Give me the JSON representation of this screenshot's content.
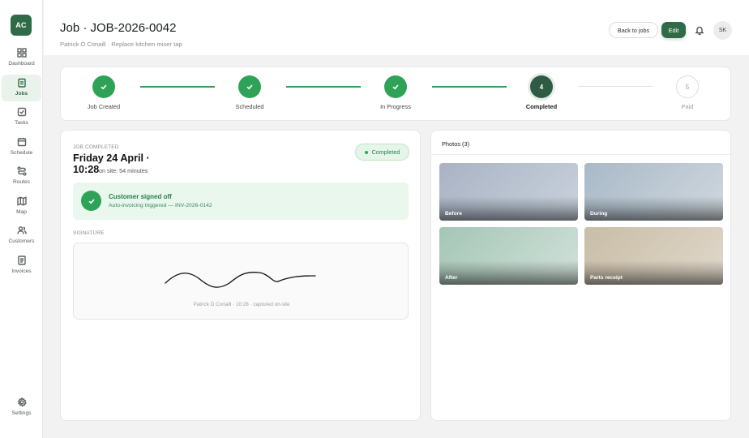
{
  "sidebar": {
    "logo": "AC",
    "items": [
      {
        "label": "Dashboard",
        "icon": "grid-icon"
      },
      {
        "label": "Jobs",
        "icon": "clipboard-icon",
        "active": true
      },
      {
        "label": "Tasks",
        "icon": "checkbox-icon"
      },
      {
        "label": "Schedule",
        "icon": "calendar-icon"
      },
      {
        "label": "Routes",
        "icon": "route-icon"
      },
      {
        "label": "Map",
        "icon": "map-icon"
      },
      {
        "label": "Customers",
        "icon": "users-icon"
      },
      {
        "label": "Invoices",
        "icon": "document-icon"
      }
    ],
    "settings": {
      "label": "Settings",
      "icon": "gear-icon"
    }
  },
  "header": {
    "title": "Job · JOB-2026-0042",
    "subtitle": "Patrick Ó Conaill · Replace kitchen mixer tap",
    "back_label": "Back to jobs",
    "edit_label": "Edit",
    "avatar_initials": "SK"
  },
  "stepper": {
    "steps": [
      {
        "label": "Job Created",
        "state": "done"
      },
      {
        "label": "Scheduled",
        "state": "done"
      },
      {
        "label": "In Progress",
        "state": "done"
      },
      {
        "label": "Completed",
        "state": "current",
        "number": "4"
      },
      {
        "label": "Paid",
        "state": "pending",
        "number": "5"
      }
    ]
  },
  "completion": {
    "eyebrow": "JOB COMPLETED",
    "date": "Friday 24 April · 10:28",
    "time_on_site": "on site: 54 minutes",
    "status": "Completed",
    "signed_title": "Customer signed off",
    "signed_sub": "Auto-invoicing triggered — INV-2026-0142",
    "signature_heading": "SIGNATURE",
    "signature_caption": "Patrick Ó Conaill · 10:28 · captured on-site"
  },
  "photos": {
    "title": "Photos (3)",
    "items": [
      {
        "label": "Before",
        "color_a": "#a9b3c4",
        "color_b": "#c9d2dc"
      },
      {
        "label": "During",
        "color_a": "#a9b9c8",
        "color_b": "#d0d8de"
      },
      {
        "label": "After",
        "color_a": "#a4c6b6",
        "color_b": "#d2e1da"
      },
      {
        "label": "Parts receipt",
        "color_a": "#c8bda6",
        "color_b": "#e0d8cb"
      }
    ]
  },
  "colors": {
    "brand": "#2f6b46",
    "success": "#2ea357"
  }
}
